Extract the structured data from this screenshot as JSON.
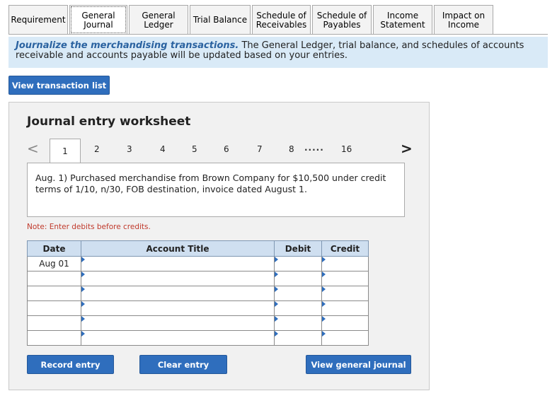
{
  "tabs": [
    {
      "label": "Requirement",
      "active": false
    },
    {
      "label": "General\nJournal",
      "active": true
    },
    {
      "label": "General\nLedger",
      "active": false
    },
    {
      "label": "Trial Balance",
      "active": false
    },
    {
      "label": "Schedule of\nReceivables",
      "active": false
    },
    {
      "label": "Schedule of\nPayables",
      "active": false
    },
    {
      "label": "Income\nStatement",
      "active": false
    },
    {
      "label": "Impact on\nIncome",
      "active": false
    }
  ],
  "banner": {
    "emphasis": "Journalize the merchandising transactions.",
    "text": " The General Ledger, trial balance, and schedules of accounts receivable and accounts payable will be updated based on your entries."
  },
  "buttons": {
    "view_transaction_list": "View transaction list",
    "record_entry": "Record entry",
    "clear_entry": "Clear entry",
    "view_general_journal": "View general journal"
  },
  "worksheet": {
    "title": "Journal entry worksheet",
    "pager": {
      "prev": "<",
      "next": ">",
      "pages": [
        "1",
        "2",
        "3",
        "4",
        "5",
        "6",
        "7",
        "8"
      ],
      "ellipsis": ".....",
      "last": "16",
      "current": "1"
    },
    "description": "Aug. 1) Purchased merchandise from Brown Company for $10,500 under credit terms of 1/10, n/30, FOB destination, invoice dated August 1.",
    "note": "Note: Enter debits before credits."
  },
  "table": {
    "headers": {
      "date": "Date",
      "account": "Account Title",
      "debit": "Debit",
      "credit": "Credit"
    },
    "rows": [
      {
        "date": "Aug 01",
        "account": "",
        "debit": "",
        "credit": ""
      },
      {
        "date": "",
        "account": "",
        "debit": "",
        "credit": ""
      },
      {
        "date": "",
        "account": "",
        "debit": "",
        "credit": ""
      },
      {
        "date": "",
        "account": "",
        "debit": "",
        "credit": ""
      },
      {
        "date": "",
        "account": "",
        "debit": "",
        "credit": ""
      },
      {
        "date": "",
        "account": "",
        "debit": "",
        "credit": ""
      }
    ]
  },
  "colors": {
    "accent": "#2f6ebd",
    "banner_bg": "#d9eaf7",
    "header_bg": "#cfdff0",
    "note": "#c0392b"
  }
}
